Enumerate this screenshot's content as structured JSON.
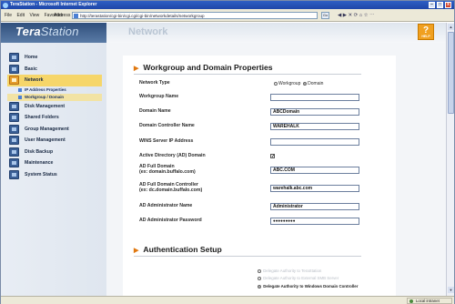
{
  "browser": {
    "title": "TeraStation - Microsoft Internet Explorer",
    "menu": [
      "File",
      "Edit",
      "View",
      "Favorites"
    ],
    "address_label": "Address",
    "address_value": "http://terastation/cgi-bin/cgi.cgi/cgi-bin/networkdetails/networkgroup",
    "go_label": "Go",
    "nav_buttons": "◀ ▶ ✕ ⟳ ⌂ ☆ ⋯",
    "status_zone": "Local intranet"
  },
  "header": {
    "logo_main": "Tera",
    "logo_sub": "Station",
    "page_heading": "Network",
    "help_label": "?",
    "help_caption": "HELP"
  },
  "sidebar": {
    "items": [
      {
        "label": "Home"
      },
      {
        "label": "Basic"
      },
      {
        "label": "Network"
      },
      {
        "label": "Disk Management"
      },
      {
        "label": "Shared Folders"
      },
      {
        "label": "Group Management"
      },
      {
        "label": "User Management"
      },
      {
        "label": "Disk Backup"
      },
      {
        "label": "Maintenance"
      },
      {
        "label": "System Status"
      }
    ],
    "subitems": [
      {
        "label": "IP Address Properties"
      },
      {
        "label": "Workgroup / Domain"
      }
    ]
  },
  "workgroup": {
    "title": "Workgroup and Domain Properties",
    "network_type_label": "Network Type",
    "option_workgroup": "Workgroup",
    "option_domain": "Domain",
    "workgroup_name_label": "Workgroup Name",
    "workgroup_name_value": "",
    "domain_name_label": "Domain Name",
    "domain_name_value": "ABCDomain",
    "dc_name_label": "Domain Controller Name",
    "dc_name_value": "WAREHALK",
    "wins_label": "WINS Server IP Address",
    "wins_value": "",
    "ad_label": "Active Directory (AD) Domain",
    "ad_checked": "✓",
    "ad_full_domain_label": "AD Full Domain",
    "ad_full_domain_example": "(ex: domain.buffalo.com)",
    "ad_full_domain_value": "ABC.COM",
    "ad_full_dc_label": "AD Full Domain Controller",
    "ad_full_dc_example": "(ex: dc.domain.buffalo.com)",
    "ad_full_dc_value": "warehalk.abc.com",
    "ad_admin_name_label": "AD Administrator Name",
    "ad_admin_name_value": "Administrator",
    "ad_admin_password_label": "AD Administrator Password",
    "ad_admin_password_value": "●●●●●●●●●"
  },
  "auth": {
    "title": "Authentication Setup",
    "options": [
      {
        "label": "Delegate Authority to TeraStation"
      },
      {
        "label": "Delegate Authority to External SMB Server"
      },
      {
        "label": "Delegate Authority to Windows Domain Controller"
      }
    ],
    "selected_index": 2
  }
}
